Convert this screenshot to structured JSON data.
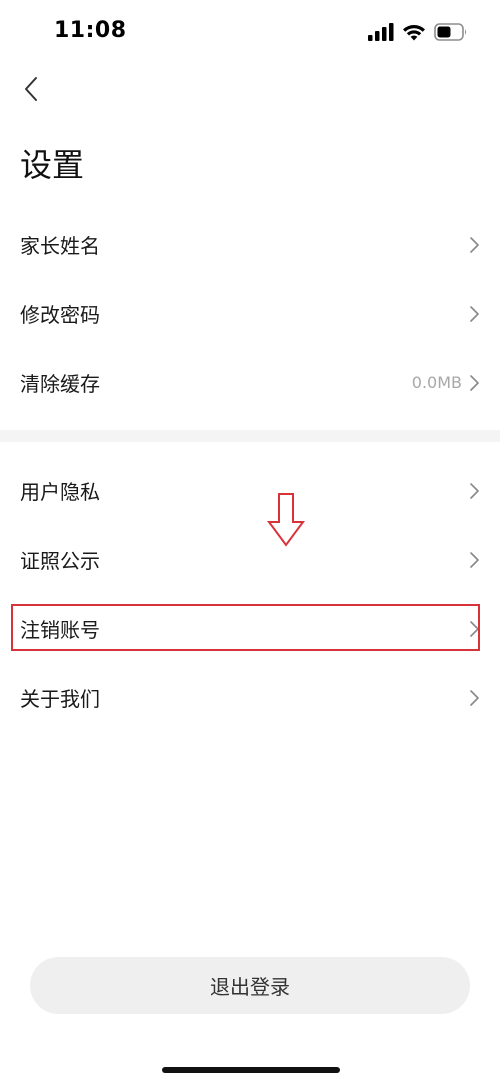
{
  "status_bar": {
    "time": "11:08",
    "icons": [
      "signal-icon",
      "wifi-icon",
      "battery-icon"
    ]
  },
  "header": {
    "back_icon": "chevron-left-icon",
    "title": "设置"
  },
  "group_1": [
    {
      "label": "家长姓名",
      "value": ""
    },
    {
      "label": "修改密码",
      "value": ""
    },
    {
      "label": "清除缓存",
      "value": "0.0MB"
    }
  ],
  "group_2": [
    {
      "label": "用户隐私",
      "value": ""
    },
    {
      "label": "证照公示",
      "value": ""
    },
    {
      "label": "注销账号",
      "value": ""
    },
    {
      "label": "关于我们",
      "value": ""
    }
  ],
  "annotation": {
    "arrow_icon": "arrow-down-icon",
    "highlight_color": "#d9333a"
  },
  "footer": {
    "logout_label": "退出登录"
  }
}
